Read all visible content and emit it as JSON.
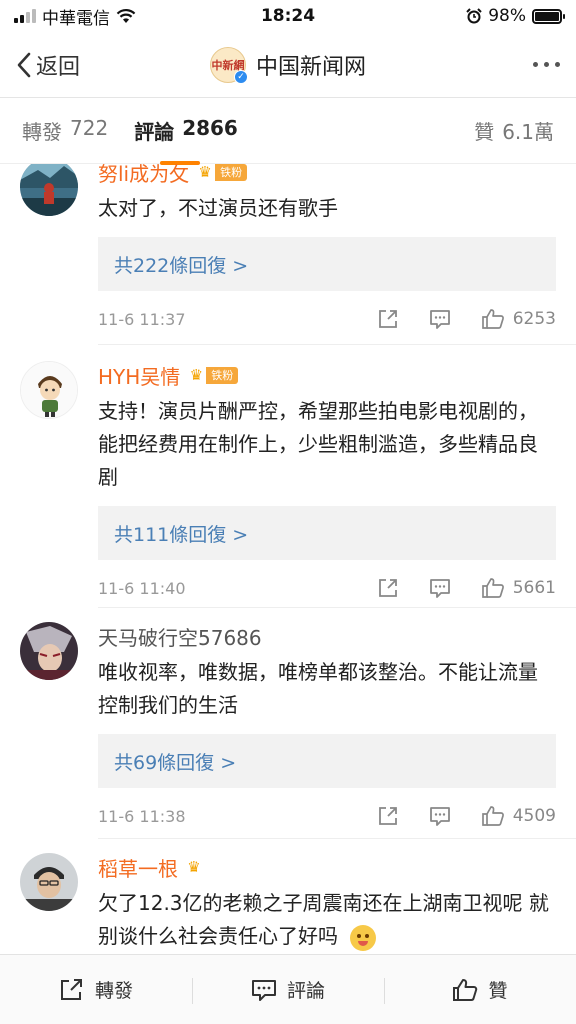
{
  "status_bar": {
    "carrier": "中華電信",
    "time": "18:24",
    "battery": "98%",
    "battery_level": 0.98
  },
  "nav": {
    "back_label": "返回",
    "title": "中国新闻网",
    "logo_text": "中新網"
  },
  "tabs": {
    "repost_label": "轉發",
    "repost_count": "722",
    "comment_label": "評論",
    "comment_count": "2866",
    "like_label": "贊",
    "like_count": "6.1萬"
  },
  "comments": [
    {
      "username": "努li成为攵",
      "badge": "铁粉",
      "username_color": "#f36b21",
      "text": "太对了，不过演员还有歌手",
      "replies": "共222條回復 >",
      "time": "11-6 11:37",
      "likes": "6253"
    },
    {
      "username": "HYH吴情",
      "badge": "铁粉",
      "username_color": "#f36b21",
      "text": "支持！演员片酬严控，希望那些拍电影电视剧的，能把经费用在制作上，少些粗制滥造，多些精品良剧",
      "replies": "共111條回復 >",
      "time": "11-6 11:40",
      "likes": "5661"
    },
    {
      "username": "天马破行空57686",
      "badge": "",
      "username_color": "#555555",
      "text": "唯收视率，唯数据，唯榜单都该整治。不能让流量控制我们的生活",
      "replies": "共69條回復 >",
      "time": "11-6 11:38",
      "likes": "4509"
    },
    {
      "username": "稻草一根",
      "badge": "",
      "username_color": "#f36b21",
      "text": "欠了12.3亿的老赖之子周震南还在上湖南卫视呢 就别谈什么社会责任心了好吗",
      "replies": "",
      "time": "",
      "likes": ""
    }
  ],
  "bottom_bar": {
    "repost": "轉發",
    "comment": "評論",
    "like": "贊"
  }
}
